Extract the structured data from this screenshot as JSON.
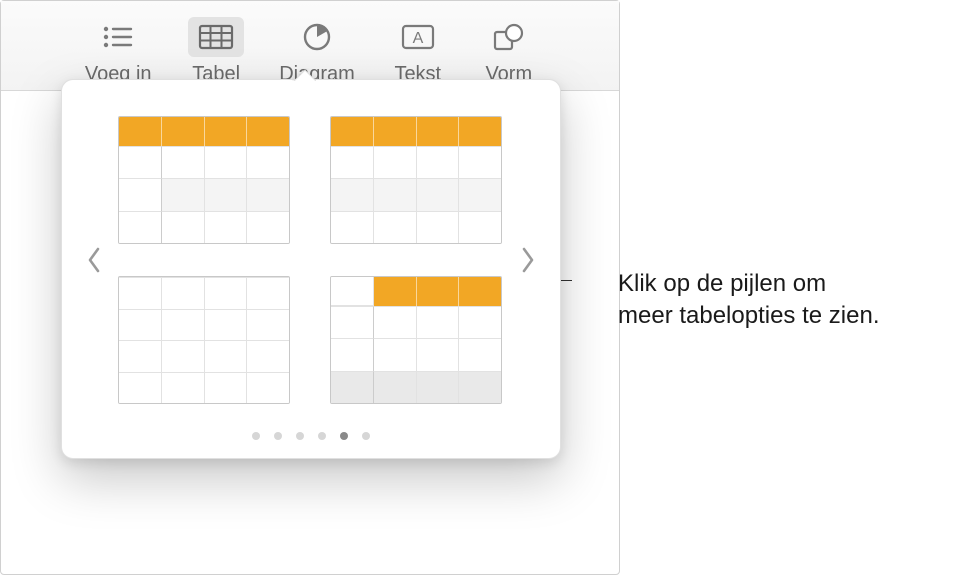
{
  "toolbar": {
    "items": [
      {
        "label": "Voeg in",
        "icon": "list-icon",
        "active": false
      },
      {
        "label": "Tabel",
        "icon": "table-icon",
        "active": true
      },
      {
        "label": "Diagram",
        "icon": "chart-icon",
        "active": false
      },
      {
        "label": "Tekst",
        "icon": "textbox-icon",
        "active": false
      },
      {
        "label": "Vorm",
        "icon": "shape-icon",
        "active": false
      }
    ]
  },
  "popover": {
    "table_styles": [
      {
        "name": "header-leftcol-alt",
        "header": true,
        "header_first_blank": false,
        "left_col": true,
        "alt_rows": true,
        "footer": false
      },
      {
        "name": "header-alt",
        "header": true,
        "header_first_blank": false,
        "left_col": false,
        "alt_rows": true,
        "footer": false
      },
      {
        "name": "plain-grid",
        "header": false,
        "header_first_blank": false,
        "left_col": false,
        "alt_rows": false,
        "footer": false
      },
      {
        "name": "header-leftcol-footer",
        "header": true,
        "header_first_blank": true,
        "left_col": true,
        "alt_rows": false,
        "footer": true
      }
    ],
    "cols": 4,
    "body_rows": 3,
    "pages": {
      "count": 6,
      "active_index": 4
    },
    "accent_color": "#f2a725"
  },
  "callout": {
    "text": "Klik op de pijlen om\nmeer tabelopties te zien."
  }
}
